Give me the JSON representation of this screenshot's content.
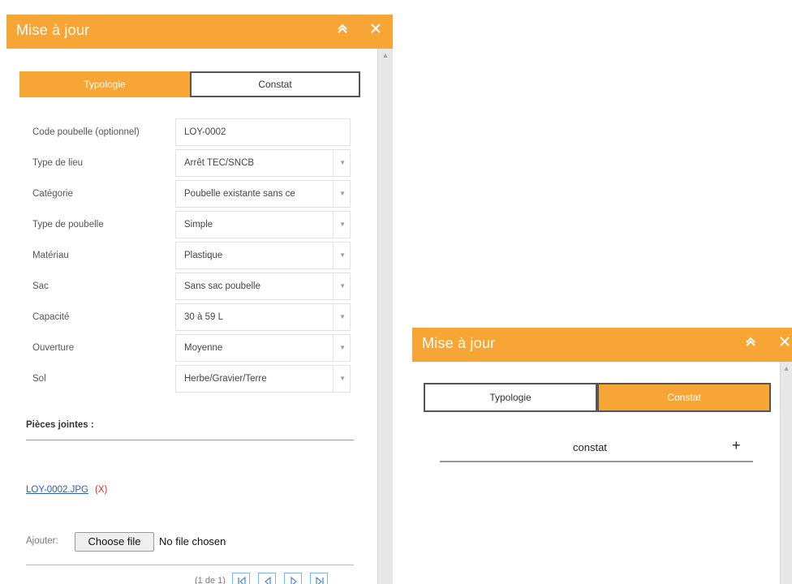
{
  "panel": {
    "title": "Mise à jour",
    "tabs": [
      {
        "label": "Typologie"
      },
      {
        "label": "Constat"
      }
    ]
  },
  "form": {
    "fields": [
      {
        "label": "Code poubelle (optionnel)",
        "value": "LOY-0002",
        "type": "text"
      },
      {
        "label": "Type de lieu",
        "value": "Arrêt TEC/SNCB",
        "type": "select"
      },
      {
        "label": "Catégorie",
        "value": "Poubelle existante sans ce",
        "type": "select"
      },
      {
        "label": "Type de poubelle",
        "value": "Simple",
        "type": "select"
      },
      {
        "label": "Matériau",
        "value": "Plastique",
        "type": "select"
      },
      {
        "label": "Sac",
        "value": "Sans sac poubelle",
        "type": "select"
      },
      {
        "label": "Capacité",
        "value": "30 à 59 L",
        "type": "select"
      },
      {
        "label": "Ouverture",
        "value": "Moyenne",
        "type": "select"
      },
      {
        "label": "Sol",
        "value": "Herbe/Gravier/Terre",
        "type": "select"
      }
    ]
  },
  "attachments": {
    "title": "Pièces jointes :",
    "files": [
      {
        "name": "LOY-0002.JPG",
        "delete": "(X)"
      }
    ],
    "add_label": "Ajouter:",
    "choose_file": "Choose file",
    "no_file": "No file chosen"
  },
  "pager": {
    "text": "(1 de 1)",
    "buttons": [
      "first",
      "previous",
      "next",
      "last"
    ]
  },
  "constat": {
    "title": "constat",
    "add_symbol": "+"
  },
  "icons": {
    "collapse": "double-chevron-up-icon",
    "close": "close-icon"
  },
  "colors": {
    "accent": "#f7a635",
    "link": "#2a5db0",
    "delete": "#e02a2a",
    "pager_border": "#7ab6e8"
  }
}
